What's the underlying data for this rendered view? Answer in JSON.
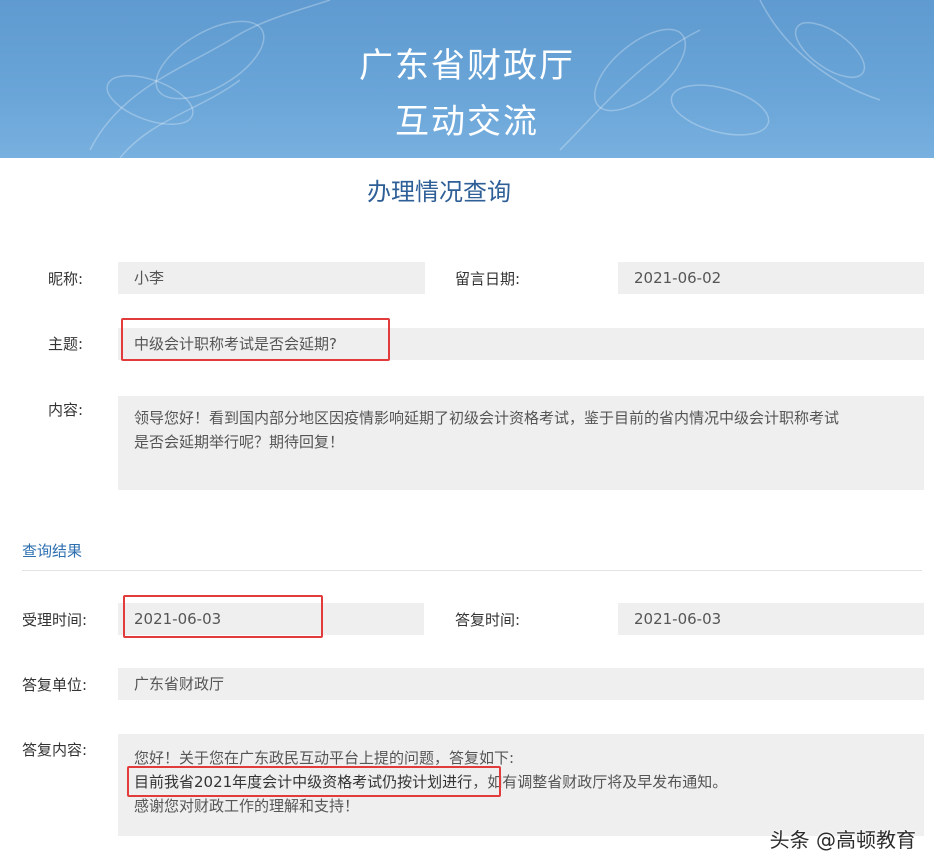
{
  "header": {
    "title_line1": "广东省财政厅",
    "title_line2": "互动交流"
  },
  "page_title": "办理情况查询",
  "query": {
    "nickname_label": "昵称:",
    "nickname_value": "小李",
    "date_label": "留言日期:",
    "date_value": "2021-06-02",
    "subject_label": "主题:",
    "subject_value": "中级会计职称考试是否会延期?",
    "content_label": "内容:",
    "content_line1": "领导您好！看到国内部分地区因疫情影响延期了初级会计资格考试，鉴于目前的省内情况中级会计职称考试",
    "content_line2": "是否会延期举行呢？期待回复！"
  },
  "result": {
    "section_title": "查询结果",
    "accept_time_label": "受理时间:",
    "accept_time_value": "2021-06-03",
    "reply_time_label": "答复时间:",
    "reply_time_value": "2021-06-03",
    "reply_unit_label": "答复单位:",
    "reply_unit_value": "广东省财政厅",
    "reply_content_label": "答复内容:",
    "reply_line1": "您好！关于您在广东政民互动平台上提的问题，答复如下:",
    "reply_line2_highlight": "目前我省2021年度会计中级资格考试仍按计划进行",
    "reply_line2_rest": "，如有调整省财政厅将及早发布通知。",
    "reply_line3": "感谢您对财政工作的理解和支持！"
  },
  "watermark": "头条 @高顿教育",
  "colors": {
    "banner": "#6aa5d8",
    "title_blue": "#2e5f97",
    "highlight_red": "#e23b3b",
    "field_gray": "#efefef"
  }
}
